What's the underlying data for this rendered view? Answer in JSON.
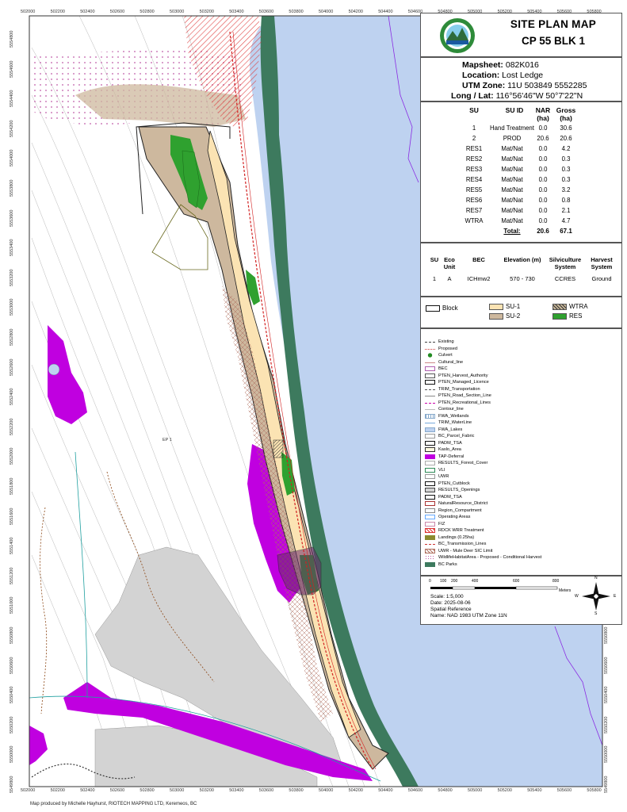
{
  "title": {
    "main": "SITE PLAN MAP",
    "sub": "CP 55 BLK 1"
  },
  "info": {
    "mapsheet_label": "Mapsheet:",
    "mapsheet": "082K016",
    "location_label": "Location:",
    "location": "Lost Ledge",
    "utm_label": "UTM Zone:",
    "utm": "11U 503849 5552285",
    "lonlat_label": "Long / Lat:",
    "lonlat": "116°56'46\"W 50°7'22\"N"
  },
  "su_table": {
    "headers": [
      "SU",
      "SU ID",
      "NAR (ha)",
      "Gross (ha)"
    ],
    "rows": [
      [
        "1",
        "Hand Treatment",
        "0.0",
        "30.6"
      ],
      [
        "2",
        "PROD",
        "20.6",
        "20.6"
      ],
      [
        "RES1",
        "Mat/Nat",
        "0.0",
        "4.2"
      ],
      [
        "RES2",
        "Mat/Nat",
        "0.0",
        "0.3"
      ],
      [
        "RES3",
        "Mat/Nat",
        "0.0",
        "0.3"
      ],
      [
        "RES4",
        "Mat/Nat",
        "0.0",
        "0.3"
      ],
      [
        "RES5",
        "Mat/Nat",
        "0.0",
        "3.2"
      ],
      [
        "RES6",
        "Mat/Nat",
        "0.0",
        "0.8"
      ],
      [
        "RES7",
        "Mat/Nat",
        "0.0",
        "2.1"
      ],
      [
        "WTRA",
        "Mat/Nat",
        "0.0",
        "4.7"
      ]
    ],
    "total_label": "Total:",
    "total_nar": "20.6",
    "total_gross": "67.1"
  },
  "eco_table": {
    "headers": [
      "SU",
      "Eco Unit",
      "BEC",
      "Elevation (m)",
      "Silviculture System",
      "Harvest System"
    ],
    "row": [
      "1",
      "A",
      "ICHmw2",
      "570 - 730",
      "CCRES",
      "Ground"
    ]
  },
  "legend_main": {
    "block": "Block",
    "su1": "SU-1",
    "su2": "SU-2",
    "wtra": "WTRA",
    "res": "RES"
  },
  "legend_layers": [
    "Existing",
    "Proposed",
    "Culvert",
    "Cultural_line",
    "BEC",
    "PTEN_Harvest_Authority",
    "PTEN_Managed_Licence",
    "TRIM_Transportation",
    "PTEN_Road_Section_Line",
    "PTEN_Recreational_Lines",
    "Contour_line",
    "FWA_Wetlands",
    "TRIM_WaterLine",
    "FWA_Lakes",
    "BC_Parcel_Fabric",
    "PADM_TSA",
    "Kaslo_Area",
    "TAP-Deferral",
    "RESULTS_Forest_Cover",
    "VLI",
    "UWR",
    "PTEN_Cutblock",
    "RESULTS_Openings",
    "PADM_TSA",
    "NaturalResource_District",
    "Region_Compartment",
    "Operating Areas",
    "FIZ",
    "RDCK WRR Treatment",
    "Landings (0.25ha)",
    "BC_Transmission_Lines",
    "UWR - Mule Deer SIC Limit",
    "WildlifeHabitatArea - Proposed - Conditional Harvest",
    "BC Parks"
  ],
  "scale": {
    "ticks": [
      "0",
      "100",
      "200",
      "400",
      "600",
      "800"
    ],
    "unit": "Meters",
    "scale": "Scale: 1:5,000",
    "date": "Date: 2025-08-06",
    "ref": "Spatial Reference",
    "name": "Name: NAD 1983 UTM Zone 11N"
  },
  "compass": {
    "n": "N",
    "s": "S",
    "e": "E",
    "w": "W"
  },
  "x_ticks": [
    "502000",
    "502200",
    "502400",
    "502600",
    "502800",
    "503000",
    "503200",
    "503400",
    "503600",
    "503800",
    "504000",
    "504200",
    "504400",
    "504600",
    "504800",
    "505000",
    "505200",
    "505400",
    "505600",
    "505800"
  ],
  "y_ticks": [
    "5554800",
    "5554600",
    "5554400",
    "5554200",
    "5554000",
    "5553800",
    "5553600",
    "5553400",
    "5553200",
    "5553000",
    "5552800",
    "5552600",
    "5552400",
    "5552200",
    "5552000",
    "5551800",
    "5551600",
    "5551400",
    "5551200",
    "5551000",
    "5550800",
    "5550600",
    "5550400",
    "5550200",
    "5550000",
    "5549800"
  ],
  "map_labels": {
    "ep": "EP 1"
  },
  "credit": "Map produced by Michelle Hayhurst, RIOTECH MAPPING LTD, Keremeos, BC",
  "colors": {
    "water": "#bed2f0",
    "park": "#3d7a5e",
    "tap": "#c000e0",
    "res": "#2fa12f",
    "su1": "#fbe3b3",
    "su2": "#cdb89e",
    "uwr": "#d3d3d3",
    "road": "#d22020"
  }
}
